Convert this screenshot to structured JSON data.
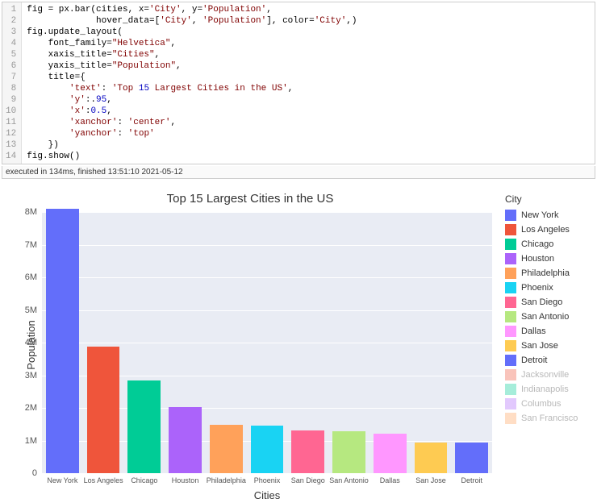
{
  "code": {
    "lines": [
      "fig = px.bar(cities, x='City', y='Population',",
      "             hover_data=['City', 'Population'], color='City',)",
      "fig.update_layout(",
      "    font_family=\"Helvetica\",",
      "    xaxis_title=\"Cities\",",
      "    yaxis_title=\"Population\",",
      "    title={",
      "        'text': 'Top 15 Largest Cities in the US',",
      "        'y':.95,",
      "        'x':0.5,",
      "        'xanchor': 'center',",
      "        'yanchor': 'top'",
      "    })",
      "fig.show()"
    ],
    "exec_info": "executed in 134ms, finished 13:51:10 2021-05-12"
  },
  "chart_data": {
    "type": "bar",
    "title": "Top 15 Largest Cities in the US",
    "xlabel": "Cities",
    "ylabel": "Population",
    "ylim": [
      0,
      8000000
    ],
    "y_ticks": [
      {
        "v": 0,
        "label": "0"
      },
      {
        "v": 1000000,
        "label": "1M"
      },
      {
        "v": 2000000,
        "label": "2M"
      },
      {
        "v": 3000000,
        "label": "3M"
      },
      {
        "v": 4000000,
        "label": "4M"
      },
      {
        "v": 5000000,
        "label": "5M"
      },
      {
        "v": 6000000,
        "label": "6M"
      },
      {
        "v": 7000000,
        "label": "7M"
      },
      {
        "v": 8000000,
        "label": "8M"
      }
    ],
    "categories": [
      "New York",
      "Los Angeles",
      "Chicago",
      "Houston",
      "Philadelphia",
      "Phoenix",
      "San Diego",
      "San Antonio",
      "Dallas",
      "San Jose",
      "Detroit"
    ],
    "values": [
      8100000,
      3870000,
      2830000,
      2030000,
      1490000,
      1450000,
      1300000,
      1280000,
      1220000,
      950000,
      930000
    ],
    "colors": [
      "#636efa",
      "#ef553b",
      "#00cc96",
      "#ab63fa",
      "#ffa15a",
      "#19d3f3",
      "#ff6692",
      "#b6e880",
      "#ff97ff",
      "#fecb52",
      "#636efa"
    ],
    "legend_title": "City",
    "legend": [
      {
        "label": "New York",
        "color": "#636efa",
        "dim": false
      },
      {
        "label": "Los Angeles",
        "color": "#ef553b",
        "dim": false
      },
      {
        "label": "Chicago",
        "color": "#00cc96",
        "dim": false
      },
      {
        "label": "Houston",
        "color": "#ab63fa",
        "dim": false
      },
      {
        "label": "Philadelphia",
        "color": "#ffa15a",
        "dim": false
      },
      {
        "label": "Phoenix",
        "color": "#19d3f3",
        "dim": false
      },
      {
        "label": "San Diego",
        "color": "#ff6692",
        "dim": false
      },
      {
        "label": "San Antonio",
        "color": "#b6e880",
        "dim": false
      },
      {
        "label": "Dallas",
        "color": "#ff97ff",
        "dim": false
      },
      {
        "label": "San Jose",
        "color": "#fecb52",
        "dim": false
      },
      {
        "label": "Detroit",
        "color": "#636efa",
        "dim": false
      },
      {
        "label": "Jacksonville",
        "color": "#ef553b",
        "dim": true
      },
      {
        "label": "Indianapolis",
        "color": "#00cc96",
        "dim": true
      },
      {
        "label": "Columbus",
        "color": "#ab63fa",
        "dim": true
      },
      {
        "label": "San Francisco",
        "color": "#ffa15a",
        "dim": true
      }
    ]
  }
}
